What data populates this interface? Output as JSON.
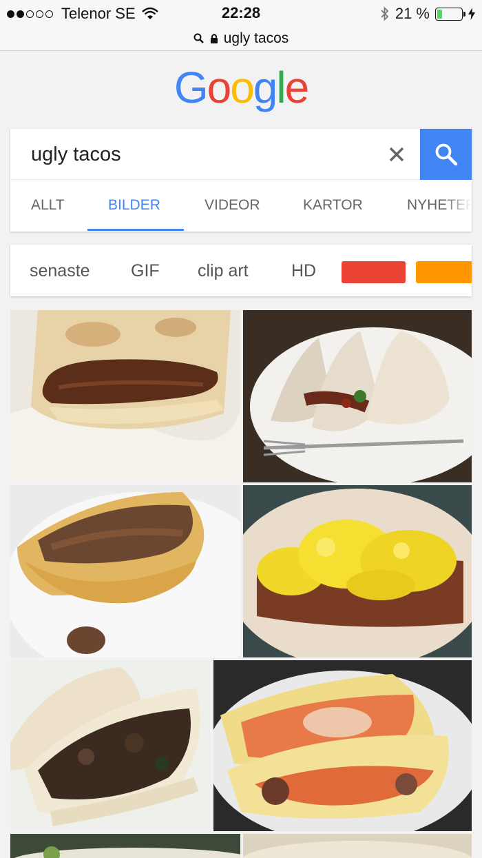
{
  "status_bar": {
    "carrier": "Telenor SE",
    "time": "22:28",
    "battery": "21 %",
    "battery_level": 0.21,
    "signal_bars": 2,
    "signal_total": 5
  },
  "url_bar": {
    "url": "ugly tacos"
  },
  "logo": {
    "letters": [
      "G",
      "o",
      "o",
      "g",
      "l",
      "e"
    ]
  },
  "search": {
    "query": "ugly tacos"
  },
  "tabs": [
    {
      "label": "ALLT"
    },
    {
      "label": "BILDER",
      "active": true
    },
    {
      "label": "VIDEOR"
    },
    {
      "label": "KARTOR"
    },
    {
      "label": "NYHETER"
    }
  ],
  "filters": {
    "chips": [
      "senaste",
      "GIF",
      "clip art",
      "HD"
    ],
    "colors": [
      "#ea4335",
      "#ff9800"
    ]
  },
  "images": [
    {
      "name": "taco-image-1"
    },
    {
      "name": "taco-image-2"
    },
    {
      "name": "taco-image-3"
    },
    {
      "name": "taco-image-4"
    },
    {
      "name": "taco-image-5"
    },
    {
      "name": "taco-image-6"
    },
    {
      "name": "taco-image-7"
    },
    {
      "name": "taco-image-8"
    }
  ]
}
